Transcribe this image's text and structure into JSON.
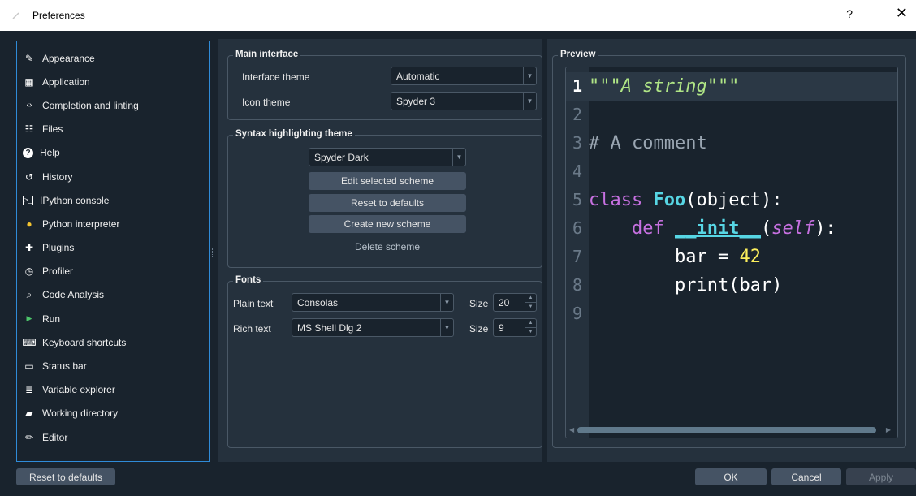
{
  "window": {
    "title": "Preferences",
    "help": "?",
    "close": "✕"
  },
  "sidebar": {
    "items": [
      {
        "label": "Appearance",
        "icon": "✎"
      },
      {
        "label": "Application",
        "icon": "▦"
      },
      {
        "label": "Completion and linting",
        "icon": "‹›"
      },
      {
        "label": "Files",
        "icon": "☷"
      },
      {
        "label": "Help",
        "icon": "?"
      },
      {
        "label": "History",
        "icon": "↺"
      },
      {
        "label": "IPython console",
        "icon": ">_"
      },
      {
        "label": "Python interpreter",
        "icon": "●"
      },
      {
        "label": "Plugins",
        "icon": "✚"
      },
      {
        "label": "Profiler",
        "icon": "◷"
      },
      {
        "label": "Code Analysis",
        "icon": "⌕"
      },
      {
        "label": "Run",
        "icon": "▶"
      },
      {
        "label": "Keyboard shortcuts",
        "icon": "⌨"
      },
      {
        "label": "Status bar",
        "icon": "▭"
      },
      {
        "label": "Variable explorer",
        "icon": "≣"
      },
      {
        "label": "Working directory",
        "icon": "▰"
      },
      {
        "label": "Editor",
        "icon": "✏"
      }
    ]
  },
  "main_interface": {
    "title": "Main interface",
    "interface_theme_label": "Interface theme",
    "interface_theme_value": "Automatic",
    "icon_theme_label": "Icon theme",
    "icon_theme_value": "Spyder 3"
  },
  "syntax": {
    "title": "Syntax highlighting theme",
    "scheme_value": "Spyder Dark",
    "edit_label": "Edit selected scheme",
    "reset_label": "Reset to defaults",
    "create_label": "Create new scheme",
    "delete_label": "Delete scheme"
  },
  "fonts": {
    "title": "Fonts",
    "plain_label": "Plain text",
    "plain_font": "Consolas",
    "plain_size_label": "Size",
    "plain_size": "20",
    "rich_label": "Rich text",
    "rich_font": "MS Shell Dlg 2",
    "rich_size_label": "Size",
    "rich_size": "9"
  },
  "preview": {
    "title": "Preview",
    "line_numbers": [
      "1",
      "2",
      "3",
      "4",
      "5",
      "6",
      "7",
      "8",
      "9"
    ],
    "code": {
      "l1_str": "\"\"\"A string\"\"\"",
      "l3_cmt": "# A comment",
      "l5_kw": "class",
      "l5_name": "Foo",
      "l5_rest": "(object):",
      "l6_kw": "def",
      "l6_name": "__init__",
      "l6_open": "(",
      "l6_self": "self",
      "l6_close": "):",
      "l7_var": "bar = ",
      "l7_num": "42",
      "l8_print": "print(bar)"
    }
  },
  "footer": {
    "reset_label": "Reset to defaults",
    "ok_label": "OK",
    "cancel_label": "Cancel",
    "apply_label": "Apply"
  },
  "colors": {
    "accent": "#2f8bd8",
    "background": "#19232d",
    "panel": "#25313d",
    "button": "#455364"
  }
}
